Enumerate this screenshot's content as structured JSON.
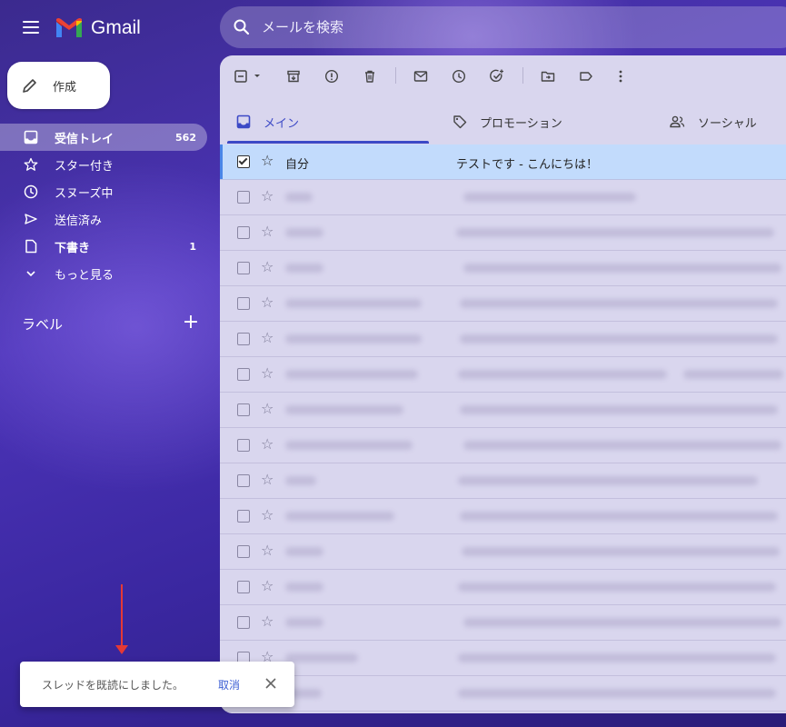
{
  "header": {
    "app_name": "Gmail",
    "search_placeholder": "メールを検索"
  },
  "compose": {
    "label": "作成"
  },
  "sidebar": {
    "items": [
      {
        "label": "受信トレイ",
        "count": "562",
        "icon": "inbox-icon",
        "active": true
      },
      {
        "label": "スター付き",
        "count": "",
        "icon": "star-icon"
      },
      {
        "label": "スヌーズ中",
        "count": "",
        "icon": "clock-icon"
      },
      {
        "label": "送信済み",
        "count": "",
        "icon": "send-icon"
      },
      {
        "label": "下書き",
        "count": "1",
        "icon": "draft-icon"
      },
      {
        "label": "もっと見る",
        "count": "",
        "icon": "chevron-down-icon"
      }
    ],
    "labels_title": "ラベル"
  },
  "tabs": [
    {
      "label": "メイン",
      "icon": "inbox-icon",
      "active": true
    },
    {
      "label": "プロモーション",
      "icon": "tag-icon"
    },
    {
      "label": "ソーシャル",
      "icon": "people-icon"
    }
  ],
  "emails": [
    {
      "sender": "自分",
      "subject": "テストです - こんにちは！",
      "selected": true
    }
  ],
  "toast": {
    "message": "スレッドを既読にしました。",
    "undo_label": "取消"
  },
  "colors": {
    "accent": "#3c49c6",
    "selected_row": "#c2dbfc",
    "annotation_arrow": "#e53935"
  }
}
